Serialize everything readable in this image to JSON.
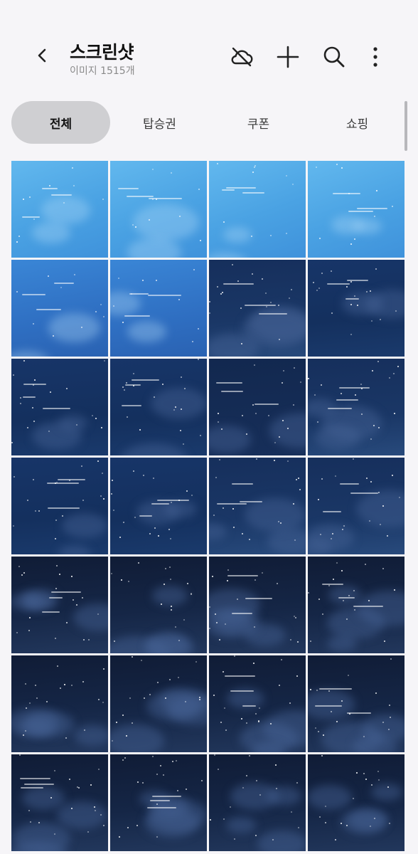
{
  "header": {
    "title": "스크린샷",
    "subtitle": "이미지 1515개",
    "back_icon": "chevron-left-icon",
    "actions": [
      "cloud-off-icon",
      "plus-icon",
      "search-icon",
      "more-vert-icon"
    ]
  },
  "tabs": [
    {
      "label": "전체",
      "selected": true
    },
    {
      "label": "탑승권",
      "selected": false
    },
    {
      "label": "쿠폰",
      "selected": false
    },
    {
      "label": "쇼핑",
      "selected": false
    }
  ],
  "colors": {
    "background": "#f6f5f8",
    "tab_active": "#cfcfd2",
    "subtitle": "#8a8a8a"
  },
  "grid": {
    "columns": 4,
    "visible_rows": 7,
    "thumbnails": [
      "light-sky",
      "light-sky",
      "light-sky",
      "light-sky",
      "mid-sky",
      "mid-sky",
      "night-clouds",
      "night-sky",
      "night-sky",
      "night-sky",
      "night-text",
      "night-clouds",
      "night-sky",
      "night-sky",
      "night-clouds",
      "night-clouds",
      "dark-clouds",
      "dark-clouds",
      "dark-clouds",
      "dark-clouds",
      "dark-clouds",
      "dark-clouds",
      "dark-clouds",
      "dark-clouds",
      "dark-clouds",
      "dark-clouds",
      "dark-clouds",
      "dark-clouds"
    ]
  }
}
